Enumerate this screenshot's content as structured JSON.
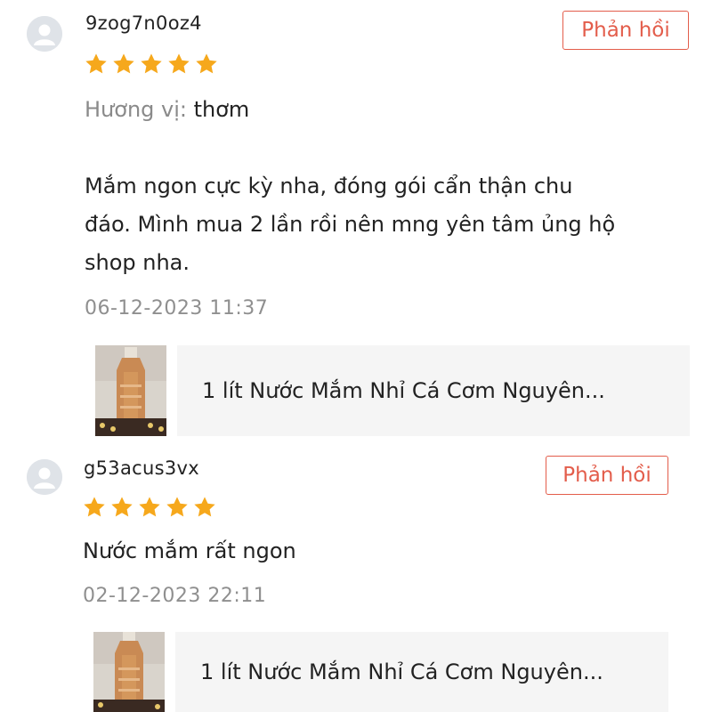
{
  "reviews": [
    {
      "username": "9zog7n0oz4",
      "reply_label": "Phản hồi",
      "rating": 5,
      "flavor_label": "Hương vị:",
      "flavor_value": "thơm",
      "comment_lines": [
        "Mắm ngon cực kỳ nha, đóng gói cẩn thận chu",
        "đáo. Mình mua 2 lần rồi nên mng yên tâm ủng hộ",
        "shop nha."
      ],
      "date": "06-12-2023 11:37",
      "product_name": "1 lít Nước Mắm Nhỉ Cá Cơm Nguyên..."
    },
    {
      "username": "g53acus3vx",
      "reply_label": "Phản hồi",
      "rating": 5,
      "comment": "Nước mắm rất ngon",
      "date": "02-12-2023 22:11",
      "product_name": "1 lít Nước Mắm Nhỉ Cá Cơm Nguyên..."
    }
  ],
  "colors": {
    "accent": "#e35d4b",
    "star": "#f6a81c",
    "muted": "#8f8f8f"
  }
}
